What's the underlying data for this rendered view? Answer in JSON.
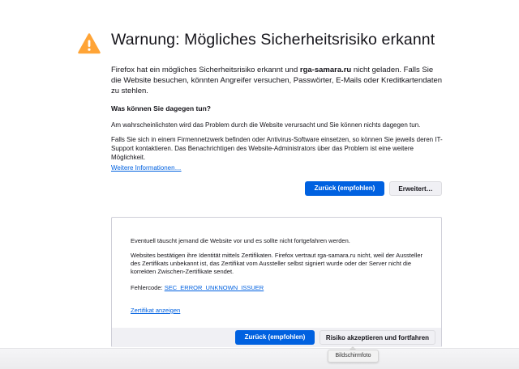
{
  "header": {
    "title": "Warnung: Mögliches Sicherheitsrisiko erkannt",
    "intro_pre": "Firefox hat ein mögliches Sicherheitsrisiko erkannt und ",
    "intro_domain": "rga-samara.ru",
    "intro_post": " nicht geladen. Falls Sie die Website besuchen, könnten Angreifer versuchen, Passwörter, E-Mails oder Kreditkartendaten zu stehlen."
  },
  "help": {
    "heading": "Was können Sie dagegen tun?",
    "paragraph1": "Am wahrscheinlichsten wird das Problem durch die Website verursacht und Sie können nichts dagegen tun.",
    "paragraph2": "Falls Sie sich in einem Firmennetzwerk befinden oder Antivirus-Software einsetzen, so können Sie jeweils deren IT-Support kontaktieren. Das Benachrichtigen des Website-Administrators über das Problem ist eine weitere Möglichkeit.",
    "more_info_link": "Weitere Informationen…"
  },
  "actions": {
    "back_button": "Zurück (empfohlen)",
    "advanced_button": "Erweitert…"
  },
  "details": {
    "line1": "Eventuell täuscht jemand die Website vor und es sollte nicht fortgefahren werden.",
    "line2": "Websites bestätigen ihre Identität mittels Zertifikaten. Firefox vertraut rga-samara.ru nicht, weil der Aussteller des Zertifikats unbekannt ist, das Zertifikat vom Aussteller selbst signiert wurde oder der Server nicht die korrekten Zwischen-Zertifikate sendet.",
    "error_code_label": "Fehlercode: ",
    "error_code": "SEC_ERROR_UNKNOWN_ISSUER",
    "view_cert_link": "Zertifikat anzeigen",
    "back_button": "Zurück (empfohlen)",
    "accept_button": "Risiko akzeptieren und fortfahren"
  },
  "tooltip": {
    "text": "Bildschirmfoto"
  },
  "colors": {
    "primary_blue": "#0061e0",
    "warning_orange": "#ffa436",
    "text": "#15141a",
    "secondary_button_bg": "#f0f0f4"
  },
  "icons": {
    "warning": "warning-triangle-icon"
  }
}
